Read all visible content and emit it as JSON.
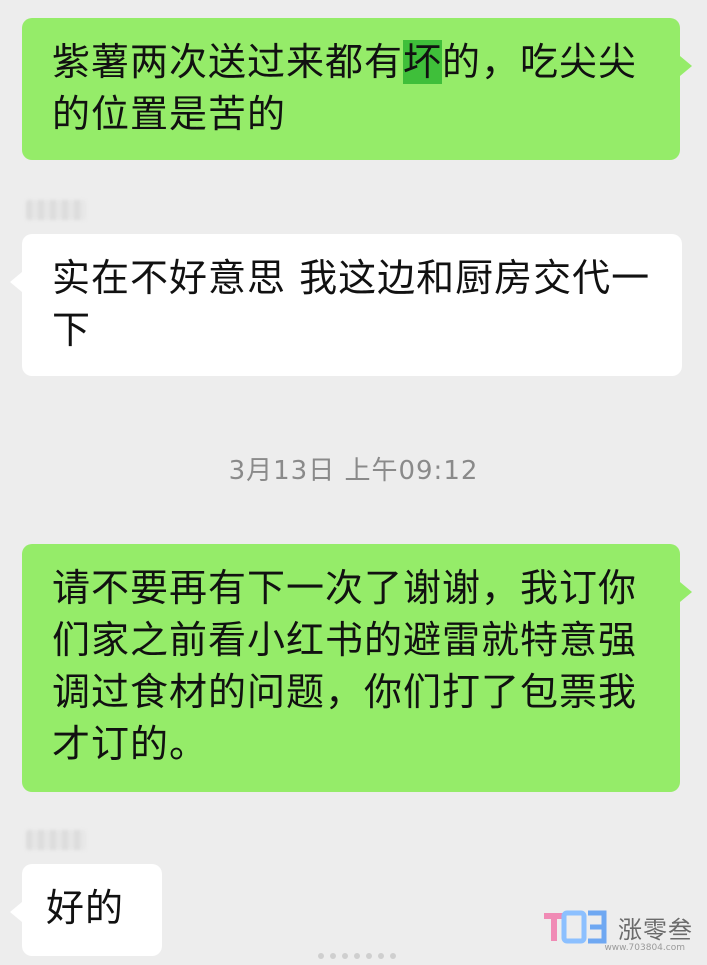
{
  "messages": [
    {
      "id": "m1",
      "direction": "outgoing",
      "text_before_highlight": "紫薯两次送过来都有",
      "highlight": "坏",
      "text_after_highlight": "的，吃尖尖的位置是苦的"
    },
    {
      "id": "m2",
      "direction": "incoming",
      "text": "实在不好意思 我这边和厨房交代一下"
    },
    {
      "id": "ts1",
      "type": "timestamp",
      "text": "3月13日 上午09:12"
    },
    {
      "id": "m3",
      "direction": "outgoing",
      "text": "请不要再有下一次了谢谢，我订你们家之前看小红书的避雷就特意强调过食材的问题，你们打了包票我才订的。"
    },
    {
      "id": "m4",
      "direction": "incoming",
      "text": "好的"
    }
  ],
  "watermark": {
    "logo_text": "TO3",
    "brand_text": "涨零叁",
    "url": "www.703804.com"
  },
  "colors": {
    "outgoing_bubble": "#95ec69",
    "incoming_bubble": "#ffffff",
    "background": "#ededed",
    "highlight": "#3fbf3a",
    "timestamp_text": "#8a8a8a"
  }
}
